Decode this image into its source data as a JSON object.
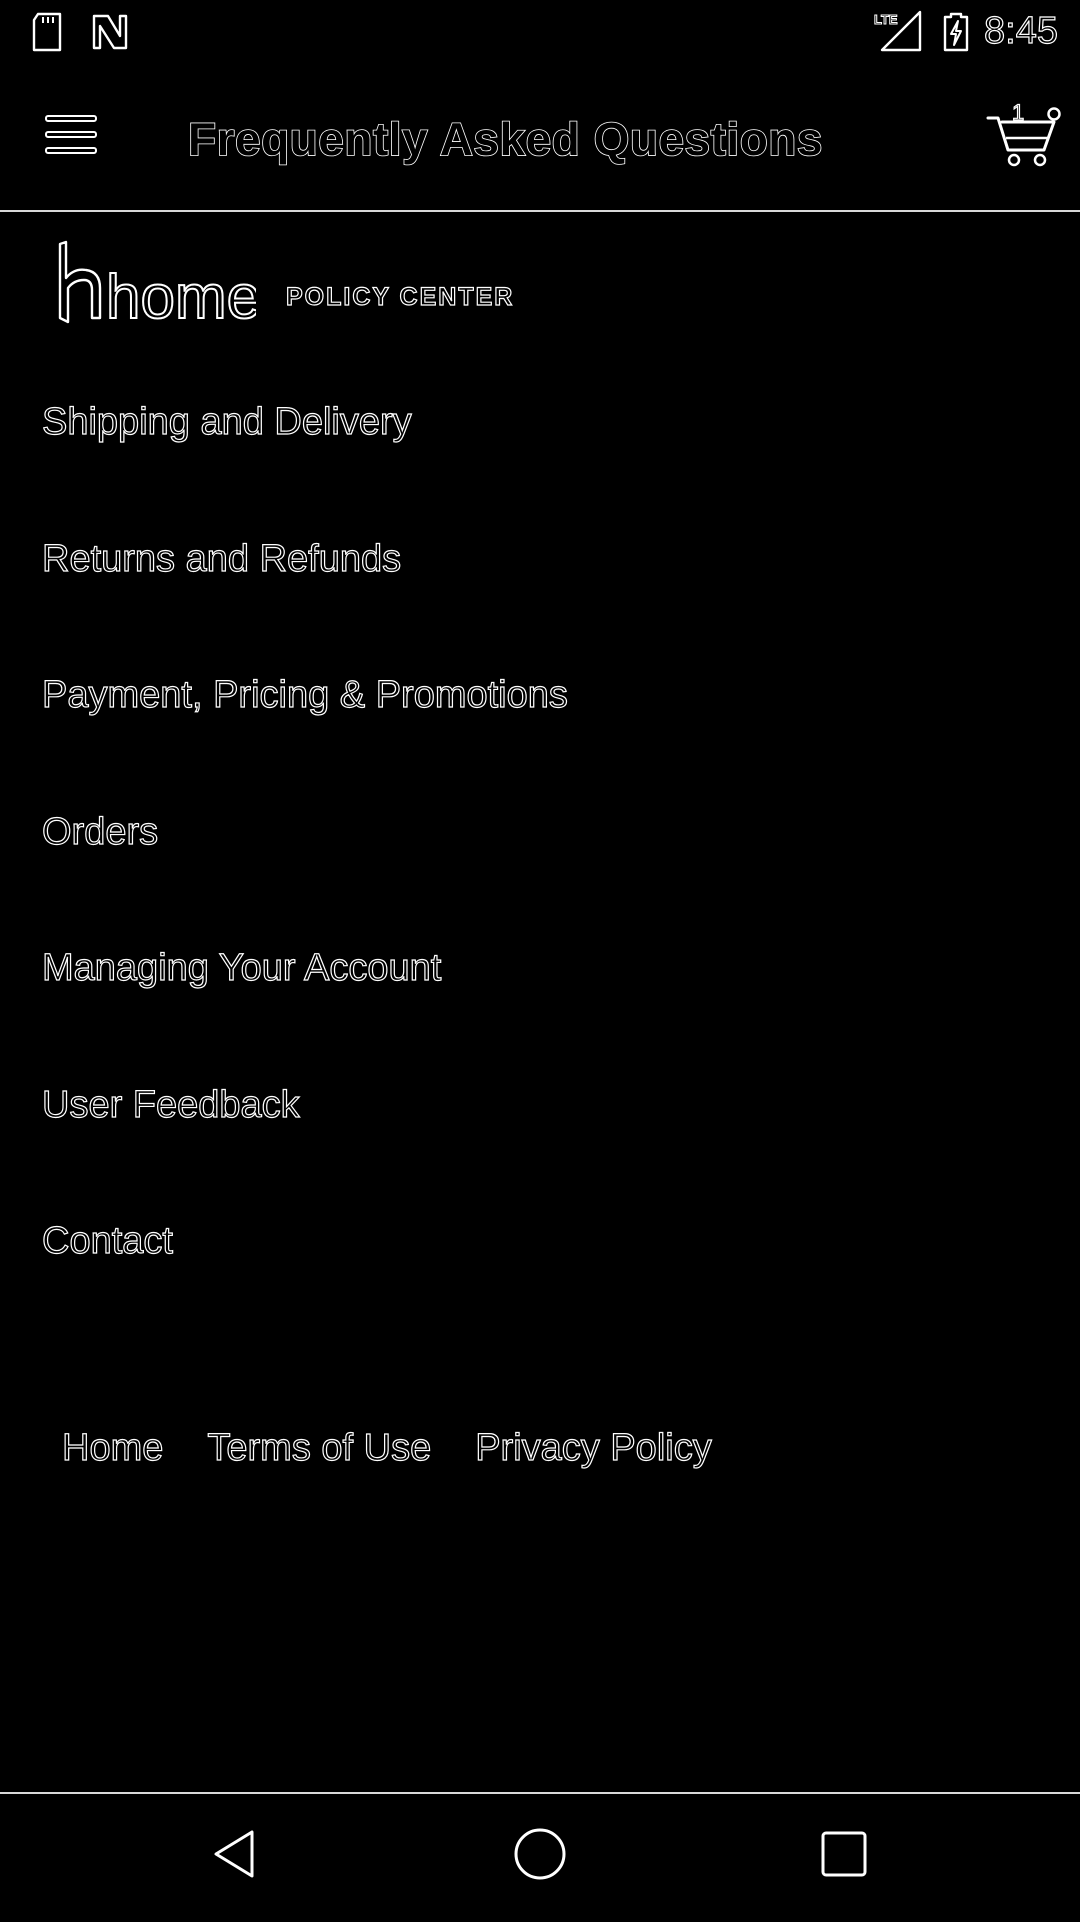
{
  "status_bar": {
    "time": "8:45",
    "network": "LTE",
    "icons": [
      "sd-card-icon",
      "n-notification-icon",
      "lte-signal-icon",
      "battery-charging-icon"
    ]
  },
  "app_bar": {
    "title": "Frequently Asked Questions",
    "menu_icon": "hamburger-menu-icon",
    "cart_icon": "shopping-cart-icon",
    "cart_count": "1"
  },
  "brand": {
    "logo_text": "home",
    "subtitle": "POLICY CENTER"
  },
  "faq": {
    "items": [
      {
        "label": "Shipping and Delivery"
      },
      {
        "label": "Returns and Refunds"
      },
      {
        "label": "Payment, Pricing & Promotions"
      },
      {
        "label": "Orders"
      },
      {
        "label": "Managing Your Account"
      },
      {
        "label": "User Feedback"
      },
      {
        "label": "Contact"
      }
    ]
  },
  "footer": {
    "links": [
      {
        "label": "Home"
      },
      {
        "label": "Terms of Use"
      },
      {
        "label": "Privacy Policy"
      }
    ]
  },
  "nav_bar": {
    "buttons": [
      "back-triangle-icon",
      "home-circle-icon",
      "recents-square-icon"
    ]
  },
  "colors": {
    "background": "#000000",
    "foreground": "#ffffff",
    "divider": "#d8d8d8"
  }
}
